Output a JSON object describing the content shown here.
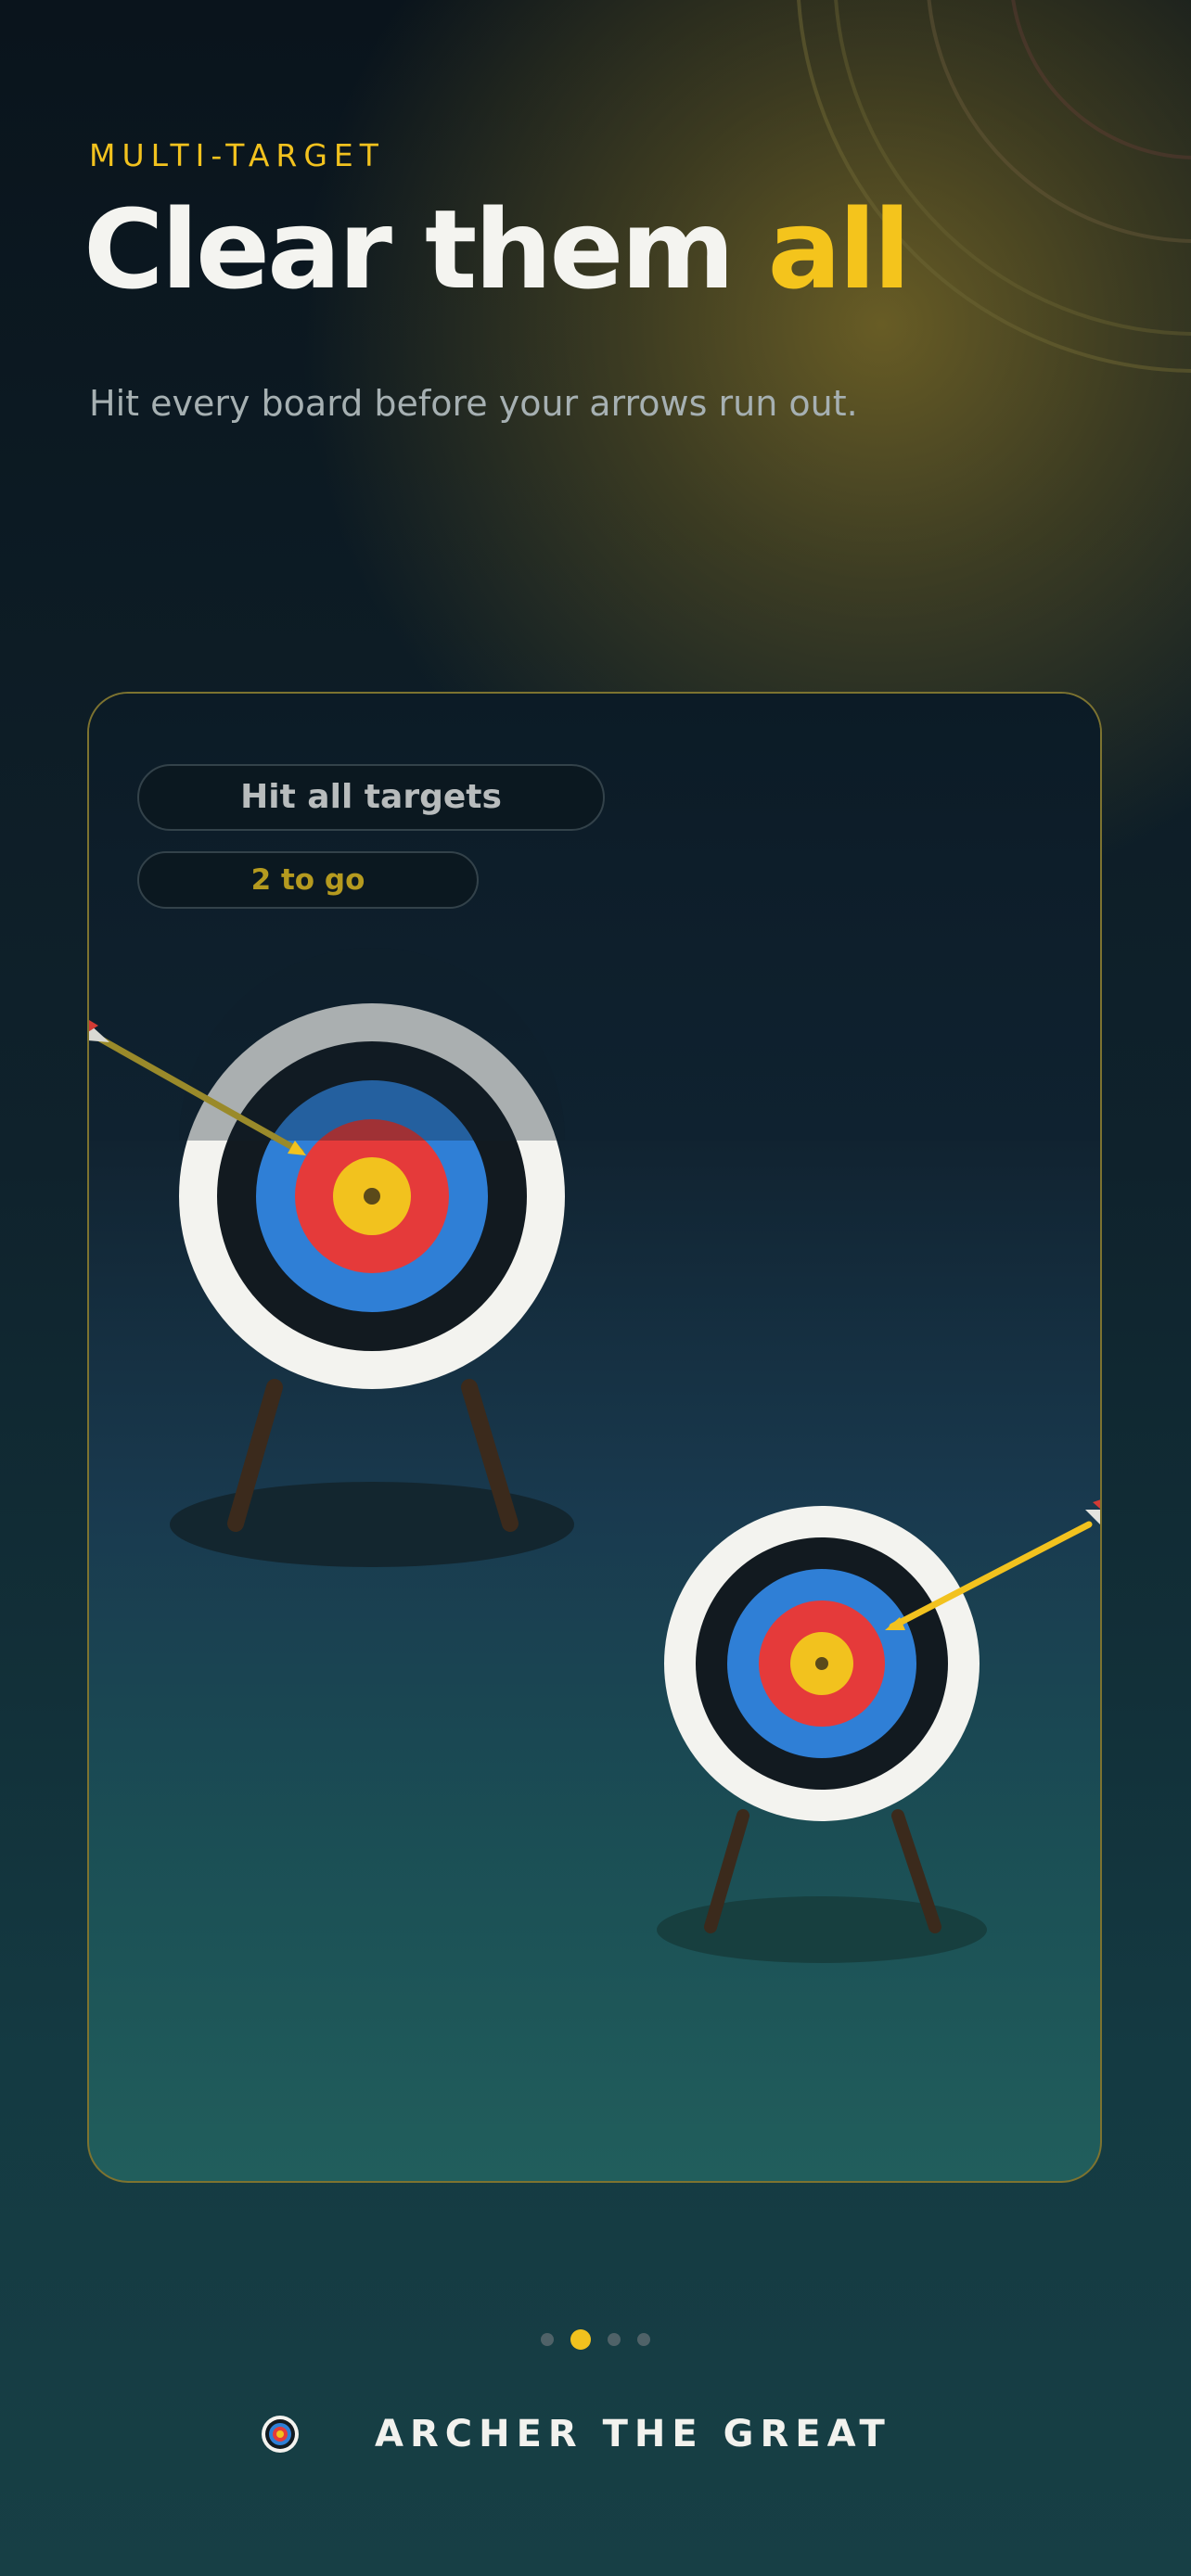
{
  "header": {
    "eyebrow": "MULTI-TARGET",
    "title_main": "Clear them ",
    "title_accent": "all",
    "subtitle": "Hit every board before your arrows run out."
  },
  "card": {
    "objective_label": "Hit all targets",
    "counter_label": "2 to go",
    "targets": [
      {
        "name": "near-target",
        "hit": true
      },
      {
        "name": "far-target",
        "hit": true
      }
    ]
  },
  "pagination": {
    "total": 4,
    "active_index": 1
  },
  "footer": {
    "brand_name": "ARCHER THE GREAT"
  },
  "colors": {
    "accent": "#f4c41c",
    "background": "#0f222c",
    "target_blue": "#2f7fd6",
    "target_red": "#e53a3a",
    "target_gold": "#f2c21e"
  }
}
